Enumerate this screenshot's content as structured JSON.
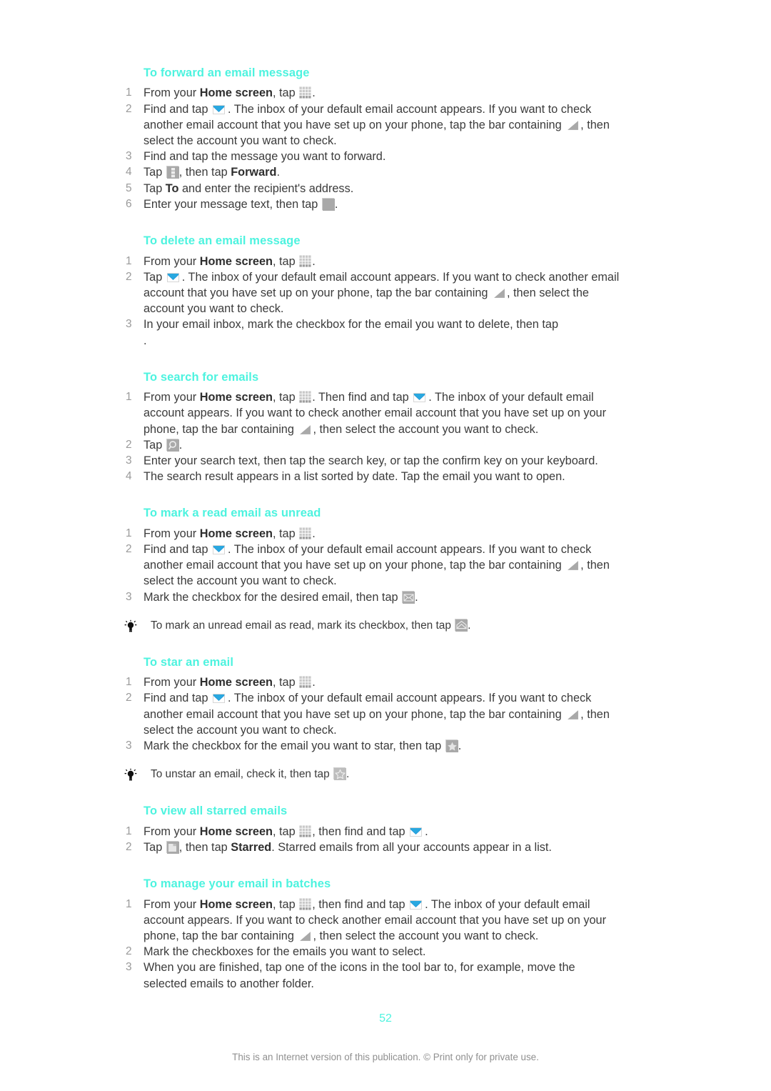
{
  "document": {
    "page_number": "52",
    "footer_note": "This is an Internet version of this publication. © Print only for private use.",
    "heading_color": "#4df3df",
    "body_color": "#3b3b3b",
    "number_color": "#9a9a9a"
  },
  "sections": [
    {
      "title": "To forward an email message",
      "steps": [
        {
          "num": "1",
          "parts": [
            {
              "t": "text",
              "v": "From your "
            },
            {
              "t": "bold",
              "v": "Home screen"
            },
            {
              "t": "text",
              "v": ", tap "
            },
            {
              "t": "icon",
              "v": "apps-grid-icon"
            },
            {
              "t": "text",
              "v": "."
            }
          ]
        },
        {
          "num": "2",
          "parts": [
            {
              "t": "text",
              "v": "Find and tap "
            },
            {
              "t": "icon",
              "v": "email-envelope-icon"
            },
            {
              "t": "text",
              "v": ". The inbox of your default email account appears. If you want to check another email account that you have set up on your phone, tap the bar containing "
            },
            {
              "t": "icon",
              "v": "triangle-expand-icon"
            },
            {
              "t": "text",
              "v": ", then select the account you want to check."
            }
          ]
        },
        {
          "num": "3",
          "parts": [
            {
              "t": "text",
              "v": "Find and tap the message you want to forward."
            }
          ]
        },
        {
          "num": "4",
          "parts": [
            {
              "t": "text",
              "v": "Tap "
            },
            {
              "t": "icon",
              "v": "overflow-menu-icon"
            },
            {
              "t": "text",
              "v": ", then tap "
            },
            {
              "t": "bold",
              "v": "Forward"
            },
            {
              "t": "text",
              "v": "."
            }
          ]
        },
        {
          "num": "5",
          "parts": [
            {
              "t": "text",
              "v": "Tap "
            },
            {
              "t": "bold",
              "v": "To"
            },
            {
              "t": "text",
              "v": " and enter the recipient's address."
            }
          ]
        },
        {
          "num": "6",
          "parts": [
            {
              "t": "text",
              "v": "Enter your message text, then tap "
            },
            {
              "t": "icon",
              "v": "send-blank-icon"
            },
            {
              "t": "text",
              "v": "."
            }
          ]
        }
      ],
      "tips": []
    },
    {
      "title": "To delete an email message",
      "steps": [
        {
          "num": "1",
          "parts": [
            {
              "t": "text",
              "v": "From your "
            },
            {
              "t": "bold",
              "v": "Home screen"
            },
            {
              "t": "text",
              "v": ", tap "
            },
            {
              "t": "icon",
              "v": "apps-grid-icon"
            },
            {
              "t": "text",
              "v": "."
            }
          ]
        },
        {
          "num": "2",
          "parts": [
            {
              "t": "text",
              "v": "Tap "
            },
            {
              "t": "icon",
              "v": "email-envelope-icon"
            },
            {
              "t": "text",
              "v": ". The inbox of your default email account appears. If you want to check another email account that you have set up on your phone, tap the bar containing "
            },
            {
              "t": "icon",
              "v": "triangle-expand-icon"
            },
            {
              "t": "text",
              "v": ", then select the account you want to check."
            }
          ]
        },
        {
          "num": "3",
          "parts": [
            {
              "t": "text",
              "v": "In your email inbox, mark the checkbox for the email you want to delete, then tap"
            },
            {
              "t": "break",
              "v": ""
            },
            {
              "t": "text",
              "v": "."
            }
          ]
        }
      ],
      "tips": []
    },
    {
      "title": "To search for emails",
      "steps": [
        {
          "num": "1",
          "parts": [
            {
              "t": "text",
              "v": "From your "
            },
            {
              "t": "bold",
              "v": "Home screen"
            },
            {
              "t": "text",
              "v": ", tap "
            },
            {
              "t": "icon",
              "v": "apps-grid-icon"
            },
            {
              "t": "text",
              "v": ". Then find and tap "
            },
            {
              "t": "icon",
              "v": "email-envelope-icon"
            },
            {
              "t": "text",
              "v": ". The inbox of your default email account appears. If you want to check another email account that you have set up on your phone, tap the bar containing "
            },
            {
              "t": "icon",
              "v": "triangle-expand-icon"
            },
            {
              "t": "text",
              "v": ", then select the account you want to check."
            }
          ]
        },
        {
          "num": "2",
          "parts": [
            {
              "t": "text",
              "v": "Tap "
            },
            {
              "t": "icon",
              "v": "search-magnifier-icon"
            },
            {
              "t": "text",
              "v": "."
            }
          ]
        },
        {
          "num": "3",
          "parts": [
            {
              "t": "text",
              "v": "Enter your search text, then tap the search key, or tap the confirm key on your keyboard."
            }
          ]
        },
        {
          "num": "4",
          "parts": [
            {
              "t": "text",
              "v": "The search result appears in a list sorted by date. Tap the email you want to open."
            }
          ]
        }
      ],
      "tips": []
    },
    {
      "title": "To mark a read email as unread",
      "steps": [
        {
          "num": "1",
          "parts": [
            {
              "t": "text",
              "v": "From your "
            },
            {
              "t": "bold",
              "v": "Home screen"
            },
            {
              "t": "text",
              "v": ", tap "
            },
            {
              "t": "icon",
              "v": "apps-grid-icon"
            },
            {
              "t": "text",
              "v": "."
            }
          ]
        },
        {
          "num": "2",
          "parts": [
            {
              "t": "text",
              "v": "Find and tap "
            },
            {
              "t": "icon",
              "v": "email-envelope-icon"
            },
            {
              "t": "text",
              "v": ". The inbox of your default email account appears. If you want to check another email account that you have set up on your phone, tap the bar containing "
            },
            {
              "t": "icon",
              "v": "triangle-expand-icon"
            },
            {
              "t": "text",
              "v": ", then select the account you want to check."
            }
          ]
        },
        {
          "num": "3",
          "parts": [
            {
              "t": "text",
              "v": "Mark the checkbox for the desired email, then tap "
            },
            {
              "t": "icon",
              "v": "mark-unread-icon"
            },
            {
              "t": "text",
              "v": "."
            }
          ]
        }
      ],
      "tips": [
        {
          "parts": [
            {
              "t": "text",
              "v": "To mark an unread email as read, mark its checkbox, then tap "
            },
            {
              "t": "icon",
              "v": "mark-read-icon"
            },
            {
              "t": "text",
              "v": "."
            }
          ]
        }
      ]
    },
    {
      "title": "To star an email",
      "steps": [
        {
          "num": "1",
          "parts": [
            {
              "t": "text",
              "v": "From your "
            },
            {
              "t": "bold",
              "v": "Home screen"
            },
            {
              "t": "text",
              "v": ", tap "
            },
            {
              "t": "icon",
              "v": "apps-grid-icon"
            },
            {
              "t": "text",
              "v": "."
            }
          ]
        },
        {
          "num": "2",
          "parts": [
            {
              "t": "text",
              "v": "Find and tap "
            },
            {
              "t": "icon",
              "v": "email-envelope-icon"
            },
            {
              "t": "text",
              "v": ". The inbox of your default email account appears. If you want to check another email account that you have set up on your phone, tap the bar containing "
            },
            {
              "t": "icon",
              "v": "triangle-expand-icon"
            },
            {
              "t": "text",
              "v": ", then select the account you want to check."
            }
          ]
        },
        {
          "num": "3",
          "parts": [
            {
              "t": "text",
              "v": "Mark the checkbox for the email you want to star, then tap "
            },
            {
              "t": "icon",
              "v": "star-filled-icon"
            },
            {
              "t": "text",
              "v": "."
            }
          ]
        }
      ],
      "tips": [
        {
          "parts": [
            {
              "t": "text",
              "v": "To unstar an email, check it, then tap "
            },
            {
              "t": "icon",
              "v": "star-outline-icon"
            },
            {
              "t": "text",
              "v": "."
            }
          ]
        }
      ]
    },
    {
      "title": "To view all starred emails",
      "steps": [
        {
          "num": "1",
          "parts": [
            {
              "t": "text",
              "v": "From your "
            },
            {
              "t": "bold",
              "v": "Home screen"
            },
            {
              "t": "text",
              "v": ", tap "
            },
            {
              "t": "icon",
              "v": "apps-grid-icon"
            },
            {
              "t": "text",
              "v": ", then find and tap "
            },
            {
              "t": "icon",
              "v": "email-envelope-icon"
            },
            {
              "t": "text",
              "v": "."
            }
          ]
        },
        {
          "num": "2",
          "parts": [
            {
              "t": "text",
              "v": "Tap "
            },
            {
              "t": "icon",
              "v": "folder-icon"
            },
            {
              "t": "text",
              "v": ", then tap "
            },
            {
              "t": "bold",
              "v": "Starred"
            },
            {
              "t": "text",
              "v": ". Starred emails from all your accounts appear in a list."
            }
          ]
        }
      ],
      "tips": []
    },
    {
      "title": "To manage your email in batches",
      "steps": [
        {
          "num": "1",
          "parts": [
            {
              "t": "text",
              "v": "From your "
            },
            {
              "t": "bold",
              "v": "Home screen"
            },
            {
              "t": "text",
              "v": ", tap "
            },
            {
              "t": "icon",
              "v": "apps-grid-icon"
            },
            {
              "t": "text",
              "v": ", then find and tap "
            },
            {
              "t": "icon",
              "v": "email-envelope-icon"
            },
            {
              "t": "text",
              "v": ". The inbox of your default email account appears. If you want to check another email account that you have set up on your phone, tap the bar containing "
            },
            {
              "t": "icon",
              "v": "triangle-expand-icon"
            },
            {
              "t": "text",
              "v": ", then select the account you want to check."
            }
          ]
        },
        {
          "num": "2",
          "parts": [
            {
              "t": "text",
              "v": "Mark the checkboxes for the emails you want to select."
            }
          ]
        },
        {
          "num": "3",
          "parts": [
            {
              "t": "text",
              "v": "When you are finished, tap one of the icons in the tool bar to, for example, move the selected emails to another folder."
            }
          ]
        }
      ],
      "tips": []
    }
  ]
}
